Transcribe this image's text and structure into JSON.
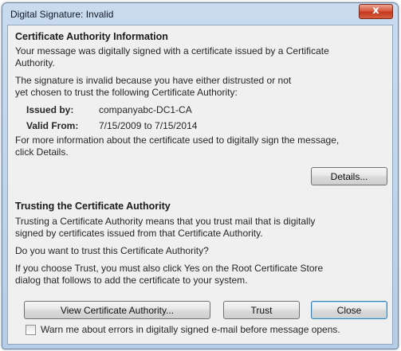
{
  "window": {
    "title": "Digital Signature: Invalid",
    "close_glyph": "x"
  },
  "ca_info": {
    "heading": "Certificate Authority Information",
    "intro_lines": [
      "Your message was digitally signed with a certificate issued by a Certificate",
      "Authority."
    ],
    "invalid_lines": [
      "The signature is invalid because you have either distrusted or not",
      "yet chosen to trust the following Certificate Authority:"
    ],
    "issued_by_label": "Issued by:",
    "issued_by_value": "companyabc-DC1-CA",
    "valid_from_label": "Valid From:",
    "valid_from_value": "7/15/2009 to 7/15/2014",
    "more_info_lines": [
      "For more information about the certificate used to digitally sign the message,",
      "click Details."
    ],
    "details_button": "Details..."
  },
  "trust": {
    "heading": "Trusting the Certificate Authority",
    "trusting_lines": [
      "Trusting a Certificate Authority means that you trust mail that is digitally",
      "signed by certificates issued from that Certificate Authority."
    ],
    "question": "Do you want to trust this Certificate Authority?",
    "choose_lines": [
      "If you choose Trust, you must also click Yes on the Root Certificate Store",
      "dialog that follows to add the certificate to your system."
    ]
  },
  "buttons": {
    "view_ca": "View Certificate Authority...",
    "trust": "Trust",
    "close": "Close"
  },
  "warn_checkbox": {
    "label": "Warn me about errors in digitally signed e-mail before message opens.",
    "checked": false
  }
}
